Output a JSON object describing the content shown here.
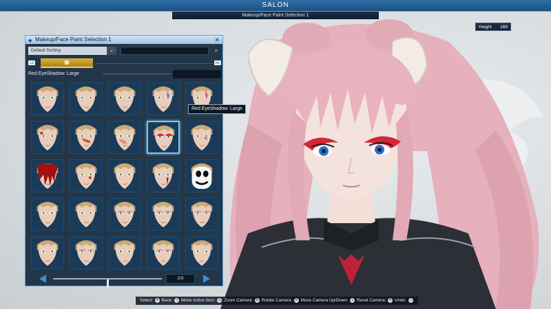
{
  "header": {
    "title": "SALON",
    "subtitle": "Makeup/Face Paint Selection 1"
  },
  "height_readout": {
    "label": "Height",
    "value": "169"
  },
  "panel": {
    "title": "Makeup/Face Paint Selection 1",
    "sort_label": "Default Sorting",
    "search_placeholder": "",
    "tab_left_key": "L1",
    "tab_right_key": "R1",
    "current_item": "Red EyeShadow: Large",
    "tooltip": "Red EyeShadow: Large",
    "page": "2/3",
    "slider_position_fraction": 0.5,
    "items": [
      {
        "paint": "none"
      },
      {
        "paint": "none"
      },
      {
        "paint": "none"
      },
      {
        "paint": "purple-cheek"
      },
      {
        "paint": "pink-cheek"
      },
      {
        "paint": "red-cheek"
      },
      {
        "paint": "red-scar"
      },
      {
        "paint": "red-scratch"
      },
      {
        "paint": "red-eyeshadow-large",
        "selected": true
      },
      {
        "paint": "red-mark"
      },
      {
        "paint": "blood"
      },
      {
        "paint": "red-dot"
      },
      {
        "paint": "none"
      },
      {
        "paint": "blood-drip"
      },
      {
        "paint": "clown"
      },
      {
        "paint": "none"
      },
      {
        "paint": "none"
      },
      {
        "paint": "light-shadow"
      },
      {
        "paint": "light-shadow"
      },
      {
        "paint": "light-shadow"
      },
      {
        "paint": "none"
      },
      {
        "paint": "light-shadow"
      },
      {
        "paint": "none"
      },
      {
        "paint": "light-shadow"
      },
      {
        "paint": "none"
      }
    ]
  },
  "controls_help": {
    "select": "Select:",
    "back": "Back:",
    "move_active_item": "Move Active Item:",
    "zoom_camera": "Zoom Camera:",
    "rotate_camera": "Rotate Camera:",
    "move_camera": "Move Camera Up/Down:",
    "reset_camera": "Reset Camera:",
    "undo": "Undo:"
  },
  "colors": {
    "accent": "#3b8ede",
    "tab_gold": "#d9b23a",
    "hair_pink": "#e8b3bf"
  }
}
